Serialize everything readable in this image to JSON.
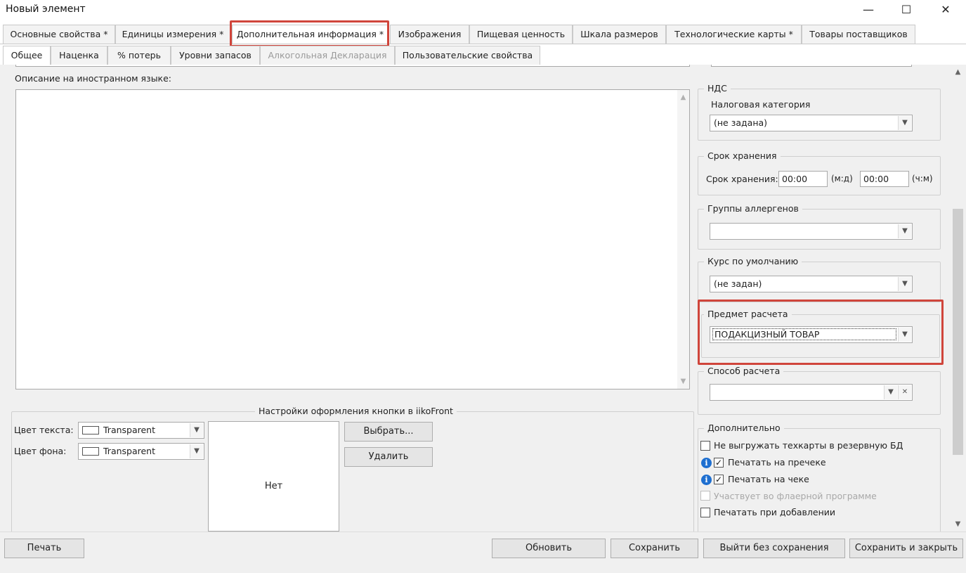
{
  "window": {
    "title": "Новый элемент",
    "minimize": "—",
    "maximize": "☐",
    "close": "✕"
  },
  "main_tabs": [
    {
      "label": "Основные свойства *"
    },
    {
      "label": "Единицы измерения *"
    },
    {
      "label": "Дополнительная информация *",
      "active": true
    },
    {
      "label": "Изображения"
    },
    {
      "label": "Пищевая ценность"
    },
    {
      "label": "Шкала размеров"
    },
    {
      "label": "Технологические карты *"
    },
    {
      "label": "Товары поставщиков"
    }
  ],
  "sub_tabs": [
    {
      "label": "Общее",
      "active": true
    },
    {
      "label": "Наценка"
    },
    {
      "label": "% потерь"
    },
    {
      "label": "Уровни запасов"
    },
    {
      "label": "Алкогольная Декларация",
      "disabled": true
    },
    {
      "label": "Пользовательские свойства"
    }
  ],
  "description": {
    "label": "Описание на иностранном языке:",
    "value": ""
  },
  "button_style": {
    "legend": "Настройки оформления кнопки в iikoFront",
    "text_color_label": "Цвет текста:",
    "text_color_value": "Transparent",
    "bg_color_label": "Цвет фона:",
    "bg_color_value": "Transparent",
    "preview_text": "Нет",
    "choose_label": "Выбрать...",
    "delete_label": "Удалить"
  },
  "vat": {
    "legend": "НДС",
    "tax_category_label": "Налоговая категория",
    "tax_category_value": "(не задана)"
  },
  "shelf_life": {
    "legend": "Срок хранения",
    "label": "Срок хранения:",
    "value1": "00:00",
    "unit1": "(м:д)",
    "value2": "00:00",
    "unit2": "(ч:м)"
  },
  "allergens": {
    "legend": "Группы аллергенов",
    "value": ""
  },
  "default_rate": {
    "legend": "Курс по умолчанию",
    "value": "(не задан)"
  },
  "payment_subject": {
    "legend": "Предмет расчета",
    "value": "ПОДАКЦИЗНЫЙ ТОВАР"
  },
  "payment_method": {
    "legend": "Способ расчета",
    "value": ""
  },
  "additional": {
    "legend": "Дополнительно",
    "items": [
      {
        "label": "Не выгружать техкарты в резервную БД",
        "checked": false,
        "info": false,
        "disabled": false
      },
      {
        "label": "Печатать на пречеке",
        "checked": true,
        "info": true,
        "disabled": false
      },
      {
        "label": "Печатать на чеке",
        "checked": true,
        "info": true,
        "disabled": false
      },
      {
        "label": "Участвует во флаерной программе",
        "checked": false,
        "info": false,
        "disabled": true
      },
      {
        "label": "Печатать при добавлении",
        "checked": false,
        "info": false,
        "disabled": false
      }
    ]
  },
  "footer": {
    "print": "Печать",
    "refresh": "Обновить",
    "save": "Сохранить",
    "exit_no_save": "Выйти без сохранения",
    "save_close": "Сохранить и закрыть"
  },
  "glyphs": {
    "check": "✓",
    "info": "i",
    "dropdown": "▼",
    "clear": "✕",
    "scroll_up": "▲",
    "scroll_down": "▼"
  },
  "colors": {
    "highlight": "#d0453b",
    "info_icon": "#1e6fd0",
    "panel_bg": "#f0f0f0"
  }
}
